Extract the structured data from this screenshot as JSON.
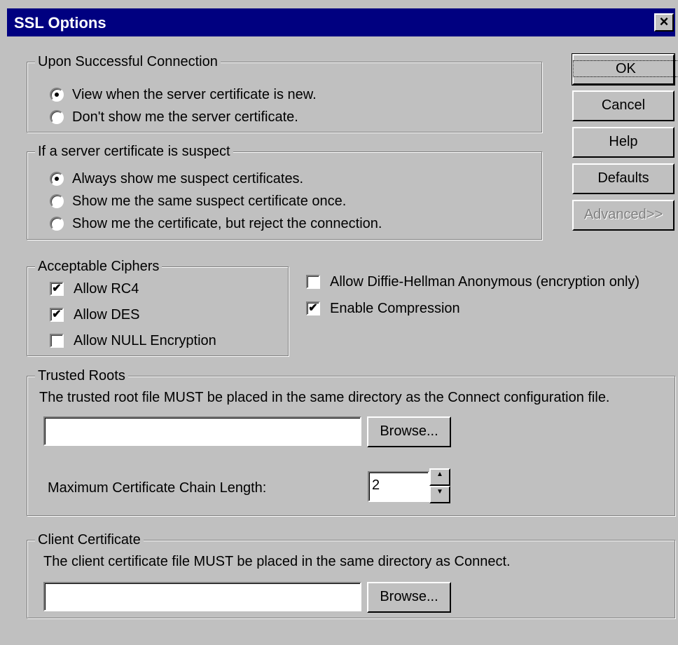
{
  "window": {
    "title": "SSL Options",
    "close_glyph": "×"
  },
  "buttons": {
    "ok": "OK",
    "cancel": "Cancel",
    "help": "Help",
    "defaults": "Defaults",
    "advanced": "Advanced>>",
    "browse_trusted": "Browse...",
    "browse_client": "Browse..."
  },
  "success_group": {
    "legend": "Upon Successful Connection",
    "options": [
      {
        "label": "View when the server certificate is new.",
        "selected": true
      },
      {
        "label": "Don't show me the server certificate.",
        "selected": false
      }
    ]
  },
  "suspect_group": {
    "legend": "If a server certificate is suspect",
    "options": [
      {
        "label": "Always show me suspect certificates.",
        "selected": true
      },
      {
        "label": "Show me the same suspect certificate once.",
        "selected": false
      },
      {
        "label": "Show me the certificate, but reject the connection.",
        "selected": false
      }
    ]
  },
  "ciphers_group": {
    "legend": "Acceptable Ciphers",
    "options": [
      {
        "label": "Allow RC4",
        "checked": true
      },
      {
        "label": "Allow DES",
        "checked": true
      },
      {
        "label": "Allow NULL Encryption",
        "checked": false
      }
    ]
  },
  "extra_options": [
    {
      "label": "Allow Diffie-Hellman Anonymous (encryption only)",
      "checked": false
    },
    {
      "label": "Enable Compression",
      "checked": true
    }
  ],
  "trusted_group": {
    "legend": "Trusted Roots",
    "description": "The trusted root file MUST be placed in the same directory as the Connect configuration file.",
    "file_value": "",
    "chain_label": "Maximum Certificate Chain Length:",
    "chain_value": "2"
  },
  "client_group": {
    "legend": "Client Certificate",
    "description": "The client certificate file MUST be placed in the same directory as Connect.",
    "file_value": ""
  },
  "icons": {
    "check_glyph": "✔",
    "spin_up": "▲",
    "spin_down": "▼"
  }
}
